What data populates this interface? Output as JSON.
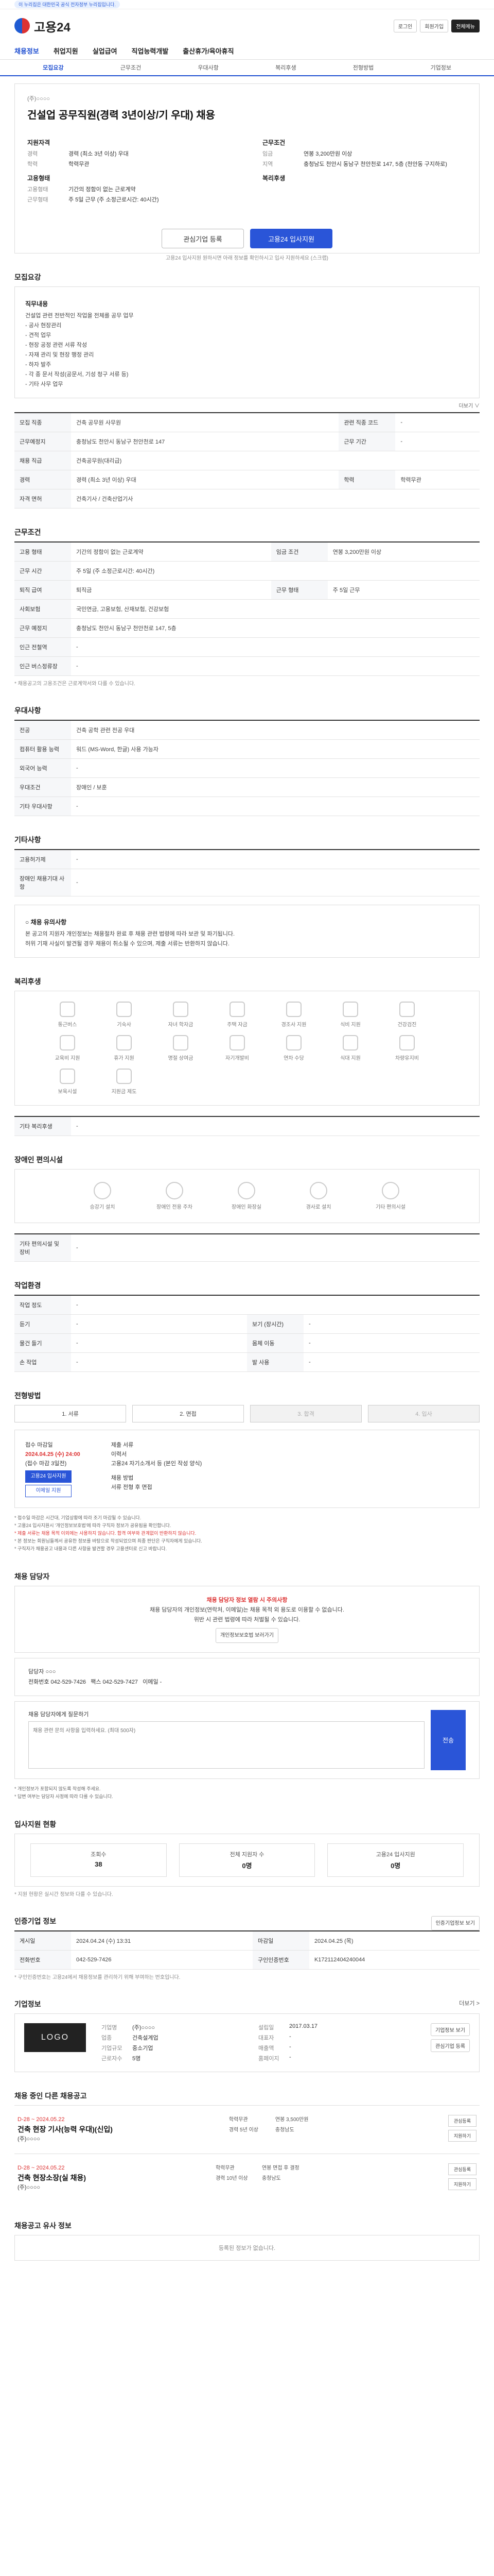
{
  "topbar": {
    "tag": "이 누리집은 대한민국 공식 전자정부 누리집입니다."
  },
  "header": {
    "logo_text": "고용24",
    "right_buttons": [
      "로그인",
      "회원가입",
      "전체메뉴"
    ]
  },
  "gnb": [
    "채용정보",
    "취업지원",
    "실업급여",
    "직업능력개발",
    "출산휴가/육아휴직"
  ],
  "tabs": [
    "모집요강",
    "근무조건",
    "우대사항",
    "복리후생",
    "전형방법",
    "기업정보"
  ],
  "job": {
    "company": "(주)○○○○",
    "title": "건설업 공무직원(경력 3년이상/기 우대) 채용",
    "left_title": "지원자격",
    "left": [
      [
        "경력",
        "경력 (최소 3년 이상) 우대"
      ],
      [
        "학력",
        "학력무관"
      ]
    ],
    "left_title2": "고용형태",
    "left2": [
      [
        "고용형태",
        "기간의 정함이 없는 근로계약"
      ],
      [
        "근무형태",
        "주 5일 근무 (주 소정근로시간: 40시간)"
      ]
    ],
    "right_title": "근무조건",
    "right": [
      [
        "임금",
        "연봉 3,200만원 이상"
      ],
      [
        "지역",
        "충청남도 천안시 동남구 천안천로 147, 5층 (천안동 구지하로)"
      ]
    ],
    "right_title2": "복리후생",
    "save_label": "관심기업 등록",
    "apply_label": "고용24 입사지원",
    "apply_note": "고용24 입사지원 원하시면 아래 정보를 확인하시고 입사 지원하세요 (스크랩)"
  },
  "recruit": {
    "heading": "모집요강",
    "body_title": "직무내용",
    "body": [
      "건설업 관련 전반적인 작업을 전체를 공무 업무",
      "- 공사 현장관리",
      "- 견적 업무",
      "- 현장 공정 관련 서류 작성",
      "- 자재 관리 및 현장 행정 관리",
      "- 하자 발주",
      "- 각 종 문서 작성(공문서, 기성 청구 서류 등)",
      "- 기타 사무 업무"
    ],
    "more": "더보기 ∨"
  },
  "recruit_table": [
    [
      "모집 직종",
      "건축 공무원 사무원",
      "관련 직종 코드",
      "-"
    ],
    [
      "근무예정지",
      "충청남도 천안시 동남구 천안천로 147",
      "근무 기간",
      "-"
    ],
    [
      "채용 직급",
      "건축공무원(대리급)",
      "",
      ""
    ],
    [
      "경력",
      "경력 (최소 3년 이상) 우대",
      "학력",
      "학력무관"
    ],
    [
      "자격 면허",
      "건축기사 / 건축산업기사",
      "",
      ""
    ]
  ],
  "conditions": {
    "heading": "근무조건",
    "table": [
      [
        "고용 형태",
        "기간의 정함이 없는 근로계약",
        "임금 조건",
        "연봉 3,200만원 이상"
      ],
      [
        "근무 시간",
        "주 5일 (주 소정근로시간: 40시간)",
        "",
        ""
      ],
      [
        "퇴직 급여",
        "퇴직금",
        "근무 형태",
        "주 5일 근무"
      ],
      [
        "사회보험",
        "국민연금, 고용보험, 산재보험, 건강보험",
        "",
        ""
      ],
      [
        "근무 예정지",
        "충청남도 천안시 동남구 천안천로 147, 5층",
        "",
        ""
      ],
      [
        "인근 전철역",
        "-",
        "",
        ""
      ],
      [
        "인근 버스정류장",
        "-",
        "",
        ""
      ]
    ],
    "note": "* 채용공고의 고용조건은 근로계약서와 다를 수 있습니다."
  },
  "preference": {
    "heading": "우대사항",
    "table": [
      [
        "전공",
        "건축 공학 관련 전공 우대"
      ],
      [
        "컴퓨터 활용 능력",
        "워드 (MS-Word, 한글) 사용 가능자"
      ],
      [
        "외국어 능력",
        "-"
      ],
      [
        "우대조건",
        "장애인 / 보훈"
      ],
      [
        "기타 우대사항",
        "-"
      ]
    ]
  },
  "etc": {
    "heading": "기타사항",
    "table": [
      [
        "고용허가제",
        "-"
      ],
      [
        "장애인 채용기대 사항",
        "-"
      ]
    ]
  },
  "notes": {
    "title": "○ 채용 유의사항",
    "lines": [
      "본 공고의 지원자 개인정보는 채용절차 완료 후 채용 관련 법령에 따라 보관 및 파기됩니다.",
      "허위 기재 사실이 발견될 경우 채용이 취소될 수 있으며, 제출 서류는 반환하지 않습니다."
    ]
  },
  "welfare": {
    "heading": "복리후생",
    "items": [
      "통근버스",
      "기숙사",
      "자녀 학자금",
      "주택 자금",
      "경조사 지원",
      "식비 지원",
      "건강검진",
      "교육비 지원",
      "휴가 지원",
      "명절 상여금",
      "자기개발비",
      "연차 수당",
      "식대 지원",
      "차량유지비",
      "보육시설",
      "지원금 제도"
    ],
    "etc_label": "기타 복리후생",
    "etc_value": "-"
  },
  "disability": {
    "heading": "장애인 편의시설",
    "items": [
      "승강기 설치",
      "장애인 전용 주차",
      "장애인 화장실",
      "경사로 설치",
      "기타 편의시설"
    ],
    "etc_label": "기타 편의시설 및 장비",
    "etc_value": "-"
  },
  "workplace": {
    "heading": "작업환경",
    "table": [
      [
        "작업 정도",
        "-",
        "",
        ""
      ],
      [
        "듣기",
        "-",
        "보기 (장시간)",
        "-"
      ],
      [
        "물건 들기",
        "-",
        "몸체 이동",
        "-"
      ],
      [
        "손 작업",
        "-",
        "발 사용",
        "-"
      ]
    ]
  },
  "process": {
    "heading": "전형방법",
    "steps": [
      "1. 서류",
      "2. 면접",
      "3. 합격",
      "4. 입사"
    ],
    "apply_title": "접수 마감일",
    "apply_date": "2024.04.25 (수) 24:00",
    "apply_range": "(접수 마감 3일전)",
    "apply_btn": "고용24 입사지원",
    "apply_btn2": "이메일 지원",
    "doc_title": "제출 서류",
    "docs": [
      "이력서",
      "고용24 자기소개서 등 (본인 작성 양식)"
    ],
    "method_title": "채용 방법",
    "method": "서류 전형 후 면접",
    "notes": [
      "* 접수일 마감은 시간대, 기업상황에 따라 조기 마감될 수 있습니다.",
      "* 고용24 입사지원시 '개인정보보호법'에 따라 구직자 정보가 공유됨을 확인합니다.",
      "* 제출 서류는 채용 목적 이외에는 사용하지 않습니다. 합격 여부와 관계없이 반환하지 않습니다.",
      "* 본 정보는 회원님들께서 공유한 정보를 바탕으로 작성되었으며 최종 판단은 구직자에게 있습니다.",
      "* 구직자가 채용공고 내용과 다른 사항을 발견할 경우 고용센터로 신고 바랍니다."
    ]
  },
  "contact": {
    "heading": "채용 담당자",
    "head_text": "채용 담당자 정보 열람 시 주의사항",
    "body": [
      "채용 담당자의 개인정보(연락처, 이메일)는 채용 목적 외 용도로 이용할 수 없습니다.",
      "위반 시 관련 법령에 따라 처벌될 수 있습니다."
    ],
    "btn": "개인정보보호법 보러가기",
    "name_label": "담당자",
    "name": "○○○",
    "tel_label": "전화번호",
    "tel": "042-529-7426",
    "fax_label": "팩스",
    "fax": "042-529-7427",
    "email_label": "이메일",
    "email": "-",
    "hint": "채용 담당자에게 질문하기",
    "qna_placeholder": "채용 관련 문의 사항을 입력하세요. (최대 500자)",
    "qna_send": "전송",
    "qna_notes": [
      "* 개인정보가 포함되지 않도록 작성해 주세요.",
      "* 답변 여부는 담당자 사정에 따라 다를 수 있습니다."
    ]
  },
  "stats": {
    "heading": "입사지원 현황",
    "items": [
      [
        "조회수",
        "38"
      ],
      [
        "전체 지원자 수",
        "0명"
      ],
      [
        "고용24 입사지원",
        "0명"
      ]
    ],
    "note": "* 지원 현황은 실시간 정보와 다를 수 있습니다."
  },
  "info": {
    "heading": "인증기업 정보",
    "btn": "인증기업정보 보기",
    "table": [
      [
        "게시일",
        "2024.04.24 (수) 13:31",
        "마감일",
        "2024.04.25 (목)"
      ],
      [
        "전화번호",
        "042-529-7426",
        "구인인증번호",
        "K172112404240044"
      ]
    ],
    "note": "* 구인인증번호는 고용24에서 채용정보를 관리하기 위해 부여하는 번호입니다."
  },
  "company": {
    "heading": "기업정보",
    "more": "더보기 >",
    "logo": "LOGO",
    "fields": [
      [
        "기업명",
        "(주)○○○○"
      ],
      [
        "설립일",
        "2017.03.17"
      ],
      [
        "업종",
        "건축설계업"
      ],
      [
        "대표자",
        "-"
      ],
      [
        "기업규모",
        "중소기업"
      ],
      [
        "매출액",
        "-"
      ],
      [
        "근로자수",
        "5명"
      ],
      [
        "홈페이지",
        "-"
      ]
    ],
    "btn1": "기업정보 보기",
    "btn2": "관심기업 등록"
  },
  "other_jobs": {
    "heading": "채용 중인 다른 채용공고",
    "items": [
      {
        "date": "D-28 ~ 2024.05.22",
        "title": "건축 현장 기사(능력 우대)(신입)",
        "sub": "(주)○○○○",
        "meta": [
          "학력무관",
          "연봉 3,500만원",
          "경력 5년 이상",
          "충청남도"
        ],
        "btns": [
          "관심등록",
          "지원하기"
        ]
      },
      {
        "date": "D-28 ~ 2024.05.22",
        "title": "건축 현장소장(실 채용)",
        "sub": "(주)○○○○",
        "meta": [
          "학력무관",
          "연봉 면접 후 결정",
          "경력 10년 이상",
          "충청남도"
        ],
        "btns": [
          "관심등록",
          "지원하기"
        ]
      }
    ]
  },
  "similar": {
    "heading": "채용공고 유사 정보",
    "empty": "등록된 정보가 없습니다."
  }
}
